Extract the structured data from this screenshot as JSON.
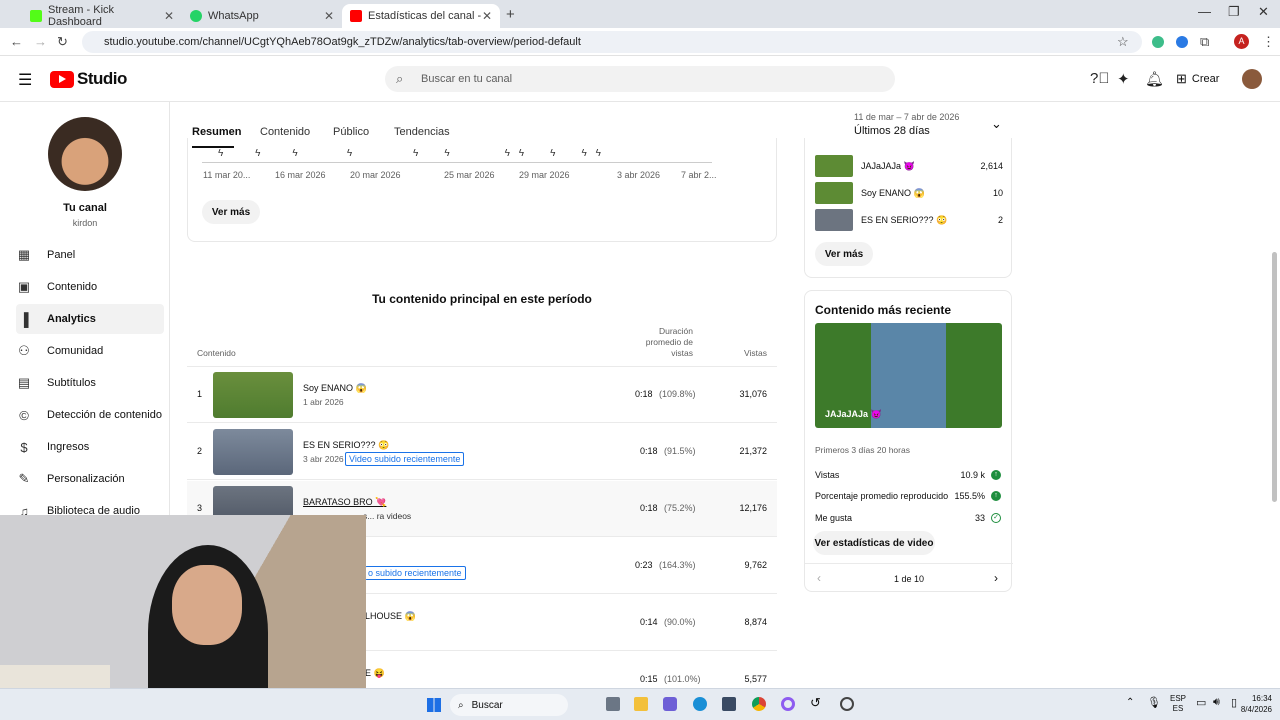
{
  "browser": {
    "tabs": [
      {
        "title": "Stream - Kick Dashboard",
        "color": "#53fc18"
      },
      {
        "title": "WhatsApp",
        "color": "#25d366"
      },
      {
        "title": "Estadísticas del canal - YouTube",
        "color": "#ff0000"
      }
    ],
    "url": "studio.youtube.com/channel/UCgtYQhAeb78Oat9gk_zTDZw/analytics/tab-overview/period-default",
    "profile_initial": "A"
  },
  "header": {
    "logo_text": "Studio",
    "search_placeholder": "Buscar en tu canal",
    "create_label": "Crear"
  },
  "sidebar": {
    "channel_title": "Tu canal",
    "channel_name": "kirdon",
    "items": [
      {
        "label": "Panel",
        "icon": "dashboard-icon"
      },
      {
        "label": "Contenido",
        "icon": "content-icon"
      },
      {
        "label": "Analytics",
        "icon": "analytics-icon",
        "active": true
      },
      {
        "label": "Comunidad",
        "icon": "community-icon"
      },
      {
        "label": "Subtítulos",
        "icon": "subtitles-icon"
      },
      {
        "label": "Detección de contenido",
        "icon": "copyright-icon"
      },
      {
        "label": "Ingresos",
        "icon": "money-icon"
      },
      {
        "label": "Personalización",
        "icon": "wand-icon"
      },
      {
        "label": "Biblioteca de audio",
        "icon": "audio-library-icon"
      }
    ]
  },
  "analytics": {
    "tabs": [
      "Resumen",
      "Contenido",
      "Público",
      "Tendencias"
    ],
    "active_tab": "Resumen",
    "date_range_detail": "11 de mar – 7 abr de 2026",
    "date_range_label": "Últimos 28 días",
    "chart_dates": [
      "11 mar 20...",
      "16 mar 2026",
      "20 mar 2026",
      "25 mar 2026",
      "29 mar 2026",
      "3 abr 2026",
      "7 abr 2..."
    ],
    "see_more": "Ver más"
  },
  "top_content": {
    "title": "Tu contenido principal en este período",
    "col_content": "Contenido",
    "col_duration": "Duración promedio de vistas",
    "col_views": "Vistas",
    "rows": [
      {
        "rank": "1",
        "title": "Soy ENANO 😱",
        "date": "1 abr 2026",
        "badge": "",
        "duration": "0:18",
        "pct": "(109.8%)",
        "views": "31,076"
      },
      {
        "rank": "2",
        "title": "ES EN SERIO??? 😳",
        "date": "3 abr 2026",
        "badge": "Video subido recientemente",
        "duration": "0:18",
        "pct": "(91.5%)",
        "views": "21,372"
      },
      {
        "rank": "3",
        "title": "BARATASO BRO 💘",
        "date": "",
        "badge": "",
        "duration": "0:18",
        "pct": "(75.2%)",
        "views": "12,176"
      },
      {
        "rank": "",
        "title": "",
        "date": "",
        "badge": "o subido recientemente",
        "duration": "0:23",
        "pct": "(164.3%)",
        "views": "9,762"
      },
      {
        "rank": "",
        "title": "LHOUSE 😱",
        "date": "",
        "badge": "",
        "duration": "0:14",
        "pct": "(90.0%)",
        "views": "8,874"
      },
      {
        "rank": "",
        "title": "E 😝",
        "date": "",
        "badge": "",
        "duration": "0:15",
        "pct": "(101.0%)",
        "views": "5,577"
      }
    ],
    "tooltip": "s... ra videos"
  },
  "right_top": {
    "items": [
      {
        "title": "JAJaJAJa 😈",
        "value": "2,614"
      },
      {
        "title": "Soy ENANO 😱",
        "value": "10"
      },
      {
        "title": "ES EN SERIO??? 😳",
        "value": "2"
      }
    ],
    "see_more": "Ver más"
  },
  "latest": {
    "title": "Contenido más reciente",
    "video_title": "JAJaJAJa 😈",
    "period": "Primeros 3 días 20 horas",
    "stats": [
      {
        "label": "Vistas",
        "value": "10.9 k",
        "icon": "arrow-up-green-icon"
      },
      {
        "label": "Porcentaje promedio reproducido",
        "value": "155.5%",
        "icon": "arrow-up-green-icon"
      },
      {
        "label": "Me gusta",
        "value": "33",
        "icon": "check-circle-icon"
      }
    ],
    "button": "Ver estadísticas de video",
    "pager": "1 de 10"
  },
  "taskbar": {
    "search_label": "Buscar",
    "lang1": "ESP",
    "lang2": "ES",
    "time": "16:34",
    "date": "8/4/2026"
  }
}
